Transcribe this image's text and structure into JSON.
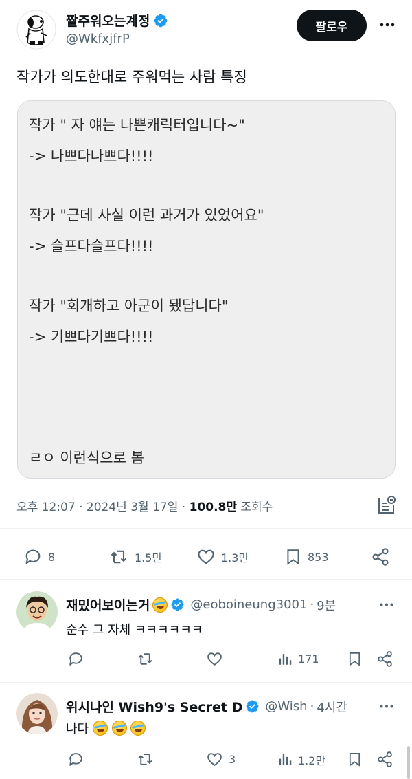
{
  "author": {
    "name": "짤주워오는계정",
    "handle": "@WkfxjfrP",
    "verified": true,
    "follow_label": "팔로우"
  },
  "tweet": {
    "text": "작가가 의도한대로 주워먹는 사람 특징",
    "quote_lines": [
      "작가 \" 자 얘는 나쁜캐릭터입니다~\"",
      "-> 나쁘다나쁘다!!!!",
      "작가 \"근데 사실 이런 과거가 있었어요\"",
      "-> 슬프다슬프다!!!!",
      "작가 \"회개하고 아군이 됐답니다\"",
      "-> 기쁘다기쁘다!!!!",
      "ㄹㅇ 이런식으로 봄"
    ],
    "meta": {
      "time": "오후 12:07",
      "date": "2024년 3월 17일",
      "views_count": "100.8만",
      "views_label": "조회수",
      "sep": "·"
    },
    "actions": {
      "replies": "8",
      "retweets": "1.5만",
      "likes": "1.3만",
      "bookmarks": "853"
    }
  },
  "replies": [
    {
      "name": "재밌어보이는거",
      "verified": true,
      "handle": "@eoboineung3001",
      "time": "9분",
      "text": "순수 그 자체 ㅋㅋㅋㅋㅋㅋ",
      "views": "171",
      "likes": ""
    },
    {
      "name": "위시나인 Wish9's Secret D",
      "verified": true,
      "handle": "@Wish",
      "time": "4시간",
      "text": "나다",
      "views": "1.2만",
      "likes": "3"
    }
  ],
  "colors": {
    "text": "#0f1419",
    "secondary": "#536471",
    "verified": "#1d9bf0",
    "button": "#0f1419",
    "card": "#efefef"
  },
  "icons": [
    "verified-badge-icon",
    "more-icon",
    "analytics-icon",
    "reply-icon",
    "retweet-icon",
    "like-icon",
    "bookmark-icon",
    "share-icon",
    "views-icon",
    "laughing-emoji-icon"
  ]
}
